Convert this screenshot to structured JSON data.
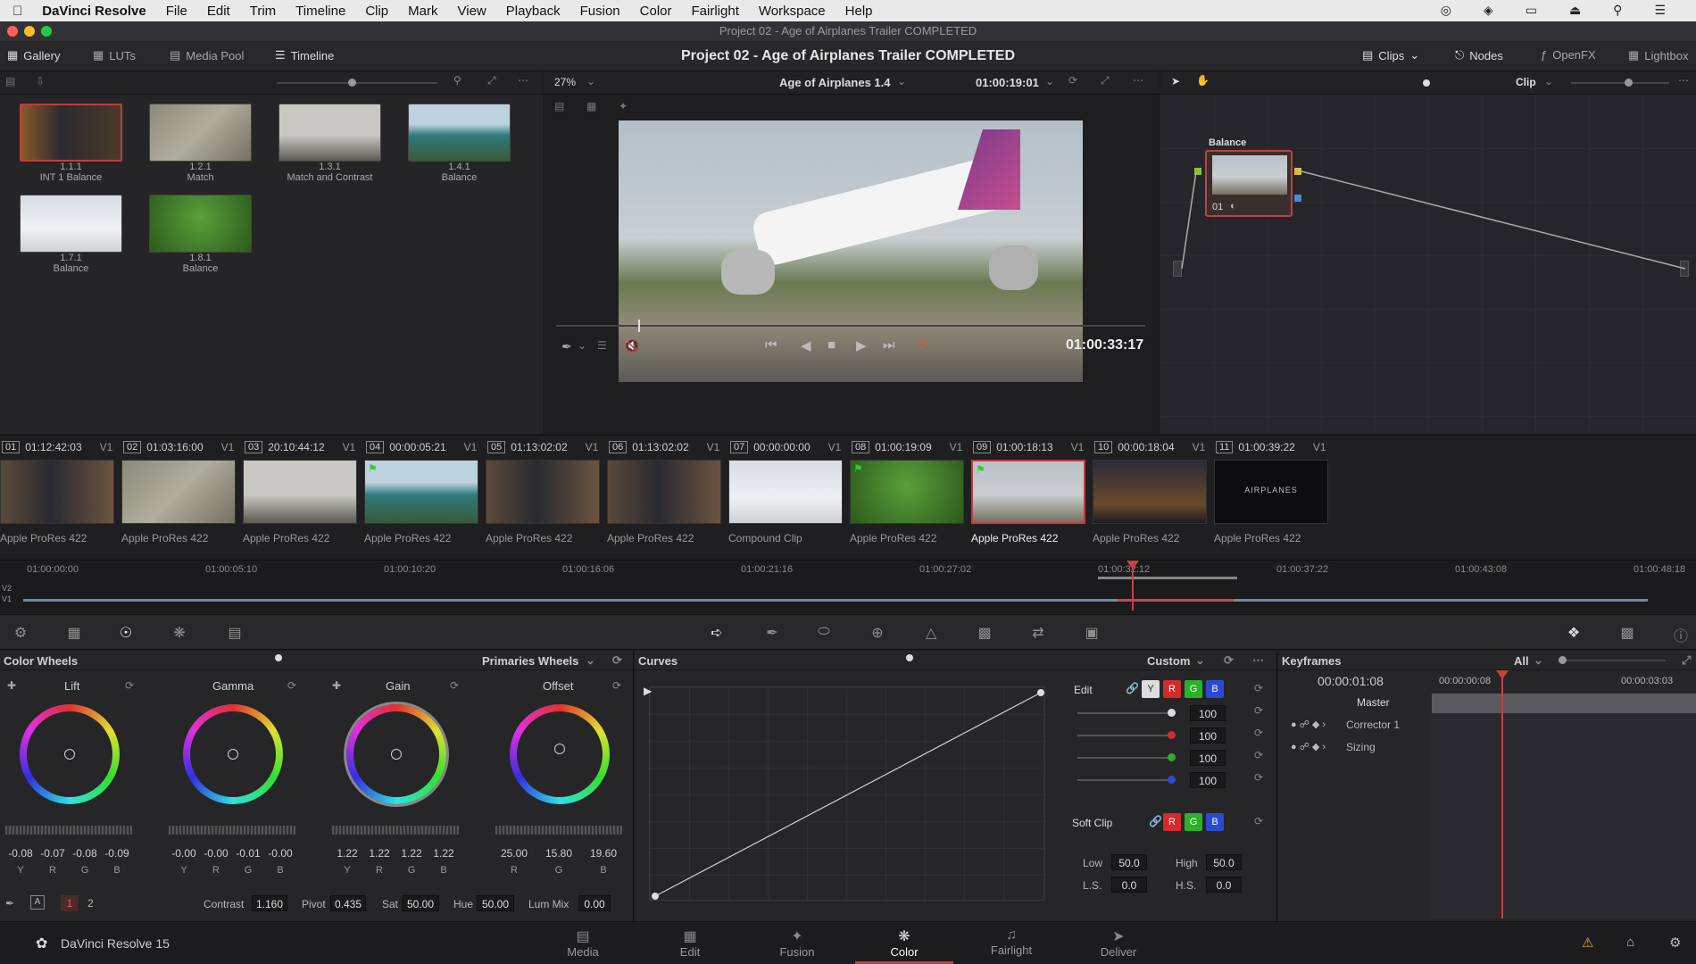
{
  "menubar": {
    "apple": "",
    "app": "DaVinci Resolve",
    "items": [
      "File",
      "Edit",
      "Trim",
      "Timeline",
      "Clip",
      "Mark",
      "View",
      "Playback",
      "Fusion",
      "Color",
      "Fairlight",
      "Workspace",
      "Help"
    ]
  },
  "window": {
    "title": "Project 02 - Age of Airplanes Trailer COMPLETED"
  },
  "toolbar": {
    "gallery": "Gallery",
    "luts": "LUTs",
    "media_pool": "Media Pool",
    "timeline": "Timeline",
    "project_title": "Project 02 - Age of Airplanes Trailer COMPLETED",
    "clips": "Clips",
    "nodes": "Nodes",
    "openfx": "OpenFX",
    "lightbox": "Lightbox"
  },
  "viewer": {
    "zoom": "27%",
    "timeline_name": "Age of Airplanes 1.4",
    "timecode_top": "01:00:19:01",
    "timecode": "01:00:33:17",
    "node_mode": "Clip"
  },
  "gallery": {
    "stills": [
      {
        "id": "1.1.1",
        "label": "INT 1 Balance"
      },
      {
        "id": "1.2.1",
        "label": "Match"
      },
      {
        "id": "1.3.1",
        "label": "Match and Contrast"
      },
      {
        "id": "1.4.1",
        "label": "Balance"
      },
      {
        "id": "1.7.1",
        "label": "Balance"
      },
      {
        "id": "1.8.1",
        "label": "Balance"
      }
    ]
  },
  "node": {
    "label": "Balance",
    "num": "01"
  },
  "clips": [
    {
      "num": "01",
      "tc": "01:12:42:03",
      "track": "V1",
      "label": "Apple ProRes 422"
    },
    {
      "num": "02",
      "tc": "01:03:16:00",
      "track": "V1",
      "label": "Apple ProRes 422"
    },
    {
      "num": "03",
      "tc": "20:10:44:12",
      "track": "V1",
      "label": "Apple ProRes 422"
    },
    {
      "num": "04",
      "tc": "00:00:05:21",
      "track": "V1",
      "label": "Apple ProRes 422"
    },
    {
      "num": "05",
      "tc": "01:13:02:02",
      "track": "V1",
      "label": "Apple ProRes 422"
    },
    {
      "num": "06",
      "tc": "01:13:02:02",
      "track": "V1",
      "label": "Apple ProRes 422"
    },
    {
      "num": "07",
      "tc": "00:00:00:00",
      "track": "V1",
      "label": "Compound Clip"
    },
    {
      "num": "08",
      "tc": "01:00:19:09",
      "track": "V1",
      "label": "Apple ProRes 422"
    },
    {
      "num": "09",
      "tc": "01:00:18:13",
      "track": "V1",
      "label": "Apple ProRes 422"
    },
    {
      "num": "10",
      "tc": "00:00:18:04",
      "track": "V1",
      "label": "Apple ProRes 422"
    },
    {
      "num": "11",
      "tc": "01:00:39:22",
      "track": "V1",
      "label": "Apple ProRes 422"
    }
  ],
  "clip11_text": "AIRPLANES",
  "timeline": {
    "ticks": [
      "01:00:00:00",
      "01:00:05:10",
      "01:00:10:20",
      "01:00:16:06",
      "01:00:21:16",
      "01:00:27:02",
      "01:00:32:12",
      "01:00:37:22",
      "01:00:43:08",
      "01:00:48:18"
    ],
    "tracks": [
      "V2",
      "V1"
    ]
  },
  "color_wheels": {
    "title": "Color Wheels",
    "mode": "Primaries Wheels",
    "wheels": [
      {
        "name": "Lift",
        "vals": [
          "-0.08",
          "-0.07",
          "-0.08",
          "-0.09"
        ],
        "chans": [
          "Y",
          "R",
          "G",
          "B"
        ]
      },
      {
        "name": "Gamma",
        "vals": [
          "-0.00",
          "-0.00",
          "-0.01",
          "-0.00"
        ],
        "chans": [
          "Y",
          "R",
          "G",
          "B"
        ]
      },
      {
        "name": "Gain",
        "vals": [
          "1.22",
          "1.22",
          "1.22",
          "1.22"
        ],
        "chans": [
          "Y",
          "R",
          "G",
          "B"
        ]
      },
      {
        "name": "Offset",
        "vals": [
          "25.00",
          "15.80",
          "19.60"
        ],
        "chans": [
          "R",
          "G",
          "B"
        ]
      }
    ],
    "page1": "1",
    "page2": "2",
    "contrast_label": "Contrast",
    "contrast": "1.160",
    "pivot_label": "Pivot",
    "pivot": "0.435",
    "sat_label": "Sat",
    "sat": "50.00",
    "hue_label": "Hue",
    "hue": "50.00",
    "lummix_label": "Lum Mix",
    "lummix": "0.00"
  },
  "curves": {
    "title": "Curves",
    "mode": "Custom",
    "edit": "Edit",
    "y": "Y",
    "r": "R",
    "g": "G",
    "b": "B",
    "edit_vals": [
      "100",
      "100",
      "100",
      "100"
    ],
    "softclip": "Soft Clip",
    "low_label": "Low",
    "low": "50.0",
    "high_label": "High",
    "high": "50.0",
    "ls_label": "L.S.",
    "ls": "0.0",
    "hs_label": "H.S.",
    "hs": "0.0"
  },
  "keyframes": {
    "title": "Keyframes",
    "filter": "All",
    "tc": "00:00:01:08",
    "t1": "00:00:00:08",
    "t2": "00:00:03:03",
    "rows": [
      "Master",
      "Corrector 1",
      "Sizing"
    ]
  },
  "pages": {
    "app_name": "DaVinci Resolve 15",
    "items": [
      "Media",
      "Edit",
      "Fusion",
      "Color",
      "Fairlight",
      "Deliver"
    ]
  }
}
